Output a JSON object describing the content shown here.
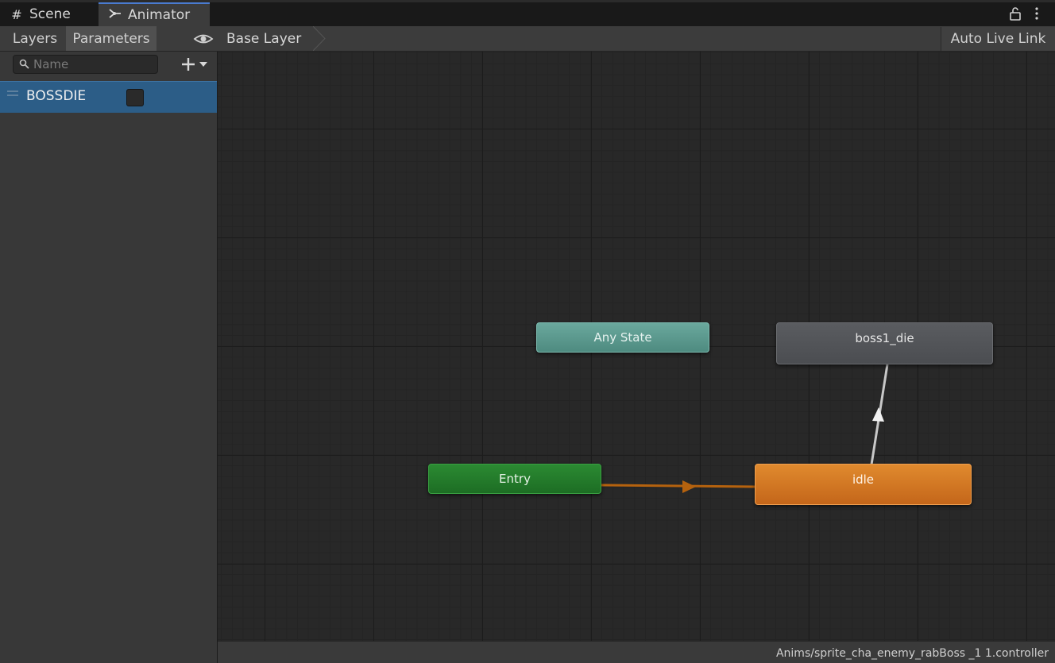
{
  "tabs": [
    {
      "label": "Scene",
      "icon": "grid-hash-icon"
    },
    {
      "label": "Animator",
      "icon": "animator-icon"
    }
  ],
  "left_panel": {
    "tabs": [
      "Layers",
      "Parameters"
    ],
    "active_tab": "Parameters",
    "search": {
      "placeholder": "Name",
      "value": ""
    },
    "parameters": [
      {
        "name": "BOSSDIE",
        "type": "bool",
        "value": false
      }
    ]
  },
  "breadcrumb": {
    "label": "Base Layer"
  },
  "toolbar": {
    "auto_live_link_label": "Auto Live Link"
  },
  "graph": {
    "states": {
      "any_state": "Any State",
      "boss1_die": "boss1_die",
      "entry": "Entry",
      "idle": "idle"
    },
    "transitions": [
      {
        "from": "Entry",
        "to": "idle",
        "kind": "default"
      },
      {
        "from": "idle",
        "to": "boss1_die",
        "kind": "normal"
      }
    ]
  },
  "status_bar": {
    "path": "Anims/sprite_cha_enemy_rabBoss _1 1.controller"
  },
  "colors": {
    "accent": "#4a7bd0",
    "selected_row": "#2c5d87",
    "any_state": "#5d9b90",
    "entry": "#247c2b",
    "default_state": "#d27624",
    "normal_state": "#54565a",
    "default_transition": "#b5620e",
    "normal_transition": "#c8c8c8"
  }
}
